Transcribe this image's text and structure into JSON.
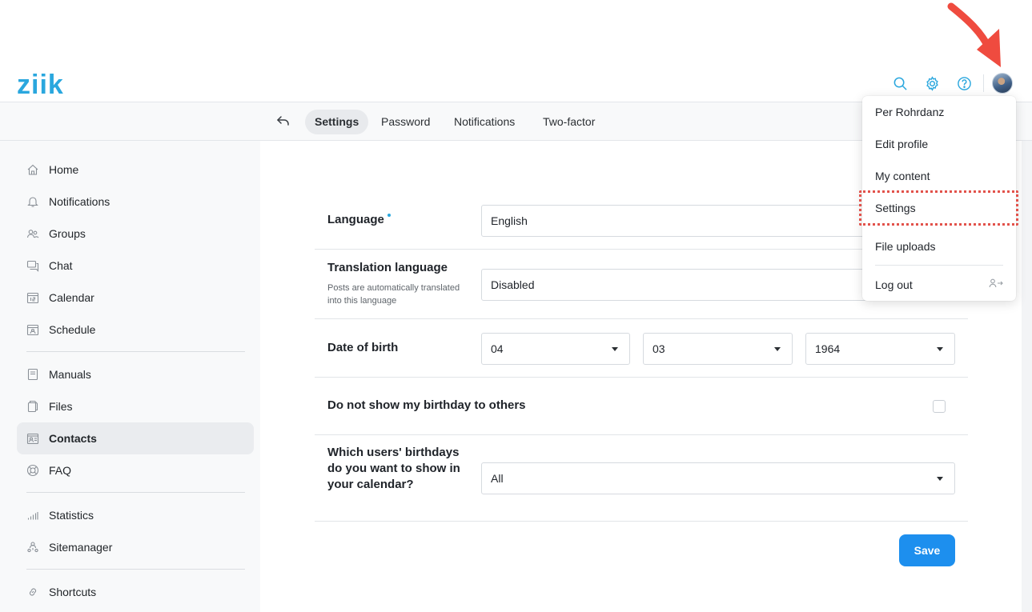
{
  "app": {
    "logo_text": "ziik",
    "brand_color": "#2aa7de",
    "accent_color": "#1d8fee"
  },
  "header": {
    "icons": [
      "search-icon",
      "gear-icon",
      "help-icon"
    ],
    "avatar": "avatar"
  },
  "subnav": {
    "tabs": [
      {
        "label": "Settings",
        "active": true
      },
      {
        "label": "Password",
        "active": false
      },
      {
        "label": "Notifications",
        "active": false
      },
      {
        "label": "Two-factor",
        "active": false
      }
    ]
  },
  "sidebar": {
    "items": [
      {
        "label": "Home",
        "icon": "home-icon"
      },
      {
        "label": "Notifications",
        "icon": "bell-icon"
      },
      {
        "label": "Groups",
        "icon": "groups-icon"
      },
      {
        "label": "Chat",
        "icon": "chat-icon"
      },
      {
        "label": "Calendar",
        "icon": "calendar-icon"
      },
      {
        "label": "Schedule",
        "icon": "schedule-icon"
      },
      {
        "label": "Manuals",
        "icon": "manual-icon"
      },
      {
        "label": "Files",
        "icon": "files-icon"
      },
      {
        "label": "Contacts",
        "icon": "contacts-icon",
        "active": true
      },
      {
        "label": "FAQ",
        "icon": "faq-icon"
      },
      {
        "label": "Statistics",
        "icon": "statistics-icon"
      },
      {
        "label": "Sitemanager",
        "icon": "sitemanager-icon"
      },
      {
        "label": "Shortcuts",
        "icon": "link-icon"
      }
    ]
  },
  "form": {
    "language": {
      "label": "Language",
      "value": "English"
    },
    "translation": {
      "label": "Translation language",
      "help": "Posts are automatically translated into this language",
      "value": "Disabled"
    },
    "dob": {
      "label": "Date of birth",
      "day": "04",
      "month": "03",
      "year": "1964"
    },
    "hide_birthday": {
      "label": "Do not show my birthday to others",
      "checked": false
    },
    "calendar_birthdays": {
      "label": "Which users' birthdays do you want to show in your calendar?",
      "value": "All"
    },
    "save_label": "Save"
  },
  "user_menu": {
    "name": "Per Rohrdanz",
    "items": [
      "Edit profile",
      "My content",
      "Settings",
      "File uploads"
    ],
    "logout": "Log out",
    "highlighted": "Settings",
    "highlight_color": "#e2524b"
  }
}
